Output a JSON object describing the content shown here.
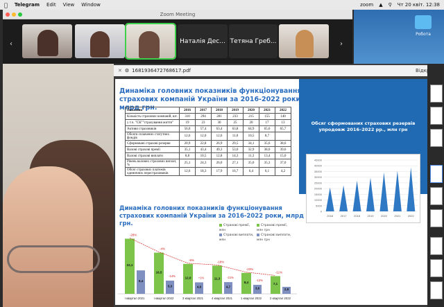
{
  "menubar": {
    "app_name": "Telegram",
    "menu_edit": "Edit",
    "menu_view": "View",
    "menu_window": "Window",
    "clock": "Чт 20 квіт. 12:38",
    "zoom_label": "zoom"
  },
  "zoom": {
    "window_title": "Zoom Meeting",
    "participants": [
      {
        "name": ""
      },
      {
        "name": ""
      },
      {
        "name": ""
      },
      {
        "name": "Наталія Дес..."
      },
      {
        "name": "Тетяна Греб..."
      },
      {
        "name": ""
      }
    ]
  },
  "desktop": {
    "folder_label": "Робота"
  },
  "pdf": {
    "filename": "1681936472768617.pdf",
    "side_label": "Відкритт"
  },
  "slide1": {
    "title": "Динаміка головних показників функціонування страхових компаній України за 2016-2022 роки, млрд грн.",
    "table": {
      "headers": [
        "Показник",
        "2016",
        "2017",
        "2018",
        "2019",
        "2020",
        "2021",
        "2022"
      ],
      "rows": [
        [
          "Кількість страхових компаній, шт.",
          "310",
          "294",
          "281",
          "233",
          "215",
          "155",
          "140"
        ],
        [
          "у т.ч. \"СК\"\"страхування життя\"",
          "19",
          "23",
          "30",
          "25",
          "20",
          "17",
          "13"
        ],
        [
          "Активи страховиків",
          "56,0",
          "57,4",
          "63,4",
          "63,8",
          "64,9",
          "65,6",
          "65,7"
        ],
        [
          "Обсяги сплачених статутних фондів",
          "12,6",
          "12,0",
          "12,6",
          "11,0",
          "10,5",
          "8,7",
          ""
        ],
        [
          "Сформовані страхові резерви",
          "20,9",
          "22,8",
          "26,9",
          "29,5",
          "34,1",
          "35,6",
          "38,6"
        ],
        [
          "Валові страхові премії",
          "35,1",
          "43,4",
          "49,3",
          "53,0",
          "32,9",
          "38,0",
          "39,6"
        ],
        [
          "Валові страхові виплати",
          "8,8",
          "10,5",
          "12,8",
          "14,3",
          "11,3",
          "13,4",
          "15,0"
        ],
        [
          "Рівень валових страхових виплат, %",
          "25,1",
          "24,3",
          "26,0",
          "27,1",
          "35,0",
          "35,3",
          "37,0"
        ],
        [
          "Обсяг страхових платежів одиничних перестраховиків",
          "12,6",
          "18,3",
          "17,9",
          "16,7",
          "6,4",
          "6,1",
          "4,2"
        ]
      ]
    },
    "panel": {
      "title": "Обсяг сформованих страхових резервів упродовж 2016–2022 рр., млн грн"
    },
    "chart_data": {
      "type": "area",
      "categories": [
        "2016",
        "2017",
        "2018",
        "2019",
        "2020",
        "2021",
        "2022"
      ],
      "values": [
        20900,
        22800,
        26900,
        29500,
        34100,
        35600,
        38600
      ],
      "title": "Обсяг сформованих страхових резервів упродовж 2016–2022 рр., млн грн",
      "ylim": [
        0,
        45000
      ],
      "yticks": [
        "0",
        "5000",
        "10000",
        "15000",
        "20000",
        "25000",
        "30000",
        "35000",
        "40000",
        "45000"
      ],
      "grid": true
    }
  },
  "slide2": {
    "title": "Динаміка головних показників функціонування страхових компаній України за 2016-2022 роки, млрд грн.",
    "legend": [
      "Страхові премії, млн",
      "Страхові премії, млн грн",
      "Страхові виплати, млн",
      "Страхові виплати, млн грн"
    ],
    "chart_data": {
      "type": "bar",
      "categories": [
        "I квартал 2021",
        "I квартал 2022",
        "3 квартал 2021",
        "4 квартал 2021",
        "1 квартал 2022",
        "2 квартал 2022"
      ],
      "series": [
        {
          "name": "Страхові премії, млн",
          "values": [
            22.1,
            16.5,
            12.0,
            11.3,
            8.4,
            7.1
          ]
        },
        {
          "name": "Страхові виплати, млн",
          "values": [
            9.4,
            5.3,
            4.6,
            4.7,
            3.6,
            2.8
          ]
        }
      ],
      "annotations": [
        "-28%",
        "-32%",
        "-4%",
        "-14%",
        "-6%",
        "+1%",
        "-18%",
        "-21%",
        "-23%",
        "-12%",
        "-11%"
      ],
      "bar_labels": [
        "22,1",
        "9,4",
        "16,5",
        "5,3",
        "12,0",
        "4,6",
        "11,3",
        "4,7",
        "8,4",
        "3,6",
        "7,1",
        "2,8"
      ],
      "ylim": [
        0,
        25
      ]
    }
  },
  "colors": {
    "title_blue": "#2a6dbf",
    "panel_blue": "#1f6ab2",
    "bar_green": "#7cc54a",
    "bar_blue": "#7f8fbf",
    "active_border": "#3ecf4b"
  }
}
